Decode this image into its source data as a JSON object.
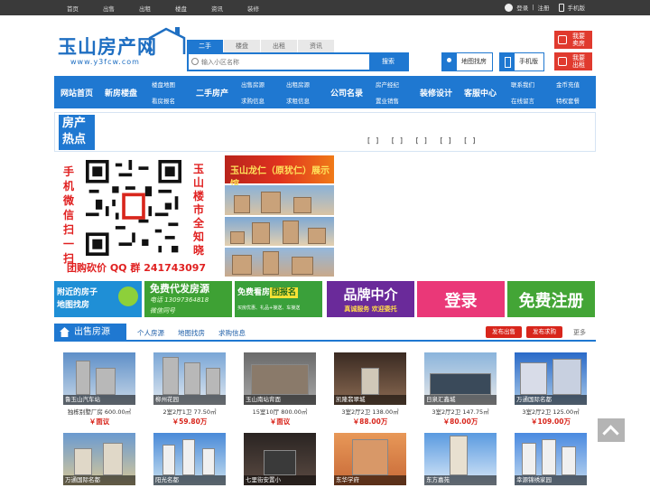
{
  "topbar": {
    "nav": [
      "首页",
      "出售",
      "出租",
      "楼盘",
      "资讯",
      "装修"
    ],
    "login": "登录",
    "separator": "|",
    "register": "注册",
    "mobile": "手机版"
  },
  "logo": {
    "title": "玉山房产网",
    "url": "www.y3fcw.com"
  },
  "search": {
    "tabs": [
      "二手",
      "楼盘",
      "出租",
      "资讯"
    ],
    "placeholder": "输入小区名称",
    "button": "搜索"
  },
  "header_buttons": {
    "map": "地图找房",
    "mobile": "手机版",
    "sell": [
      "我要",
      "卖房"
    ],
    "rent": [
      "我要",
      "出租"
    ]
  },
  "menu": {
    "home": "网站首页",
    "new": "新房楼盘",
    "new_sub": [
      "楼盘地图",
      "看房报名"
    ],
    "second": "二手房产",
    "second_sub": [
      "出售房源",
      "求购信息"
    ],
    "rent_sub": [
      "出租房源",
      "求租信息"
    ],
    "company": "公司名录",
    "company_sub": [
      "房产经纪",
      "置业销售"
    ],
    "decor": "装修设计",
    "service": "客服中心",
    "service_sub": [
      "联系我们",
      "在线留言"
    ],
    "extra_sub": [
      "金币充值",
      "特权套餐"
    ]
  },
  "hot": {
    "label_1": "房产",
    "label_2": "热点",
    "marks": "[] [] [] [] []"
  },
  "qr_ad": {
    "left": "手机微信扫一扫",
    "right": "玉山楼市全知晓",
    "bottom": "团购砍价 QQ 群 241743097"
  },
  "side_ads": {
    "top": "玉山龙仁（原犹仁）展示馆"
  },
  "banners": {
    "b1": [
      "附近的房子",
      "地图找房"
    ],
    "b2_title": "免费代发房源",
    "b2_phone": "电话 13097364818",
    "b2_sub": "微信同号",
    "b3_a": "免费看房",
    "b3_b": "团报名",
    "b3_sub": "买房优惠、礼品+接送、车接送",
    "b4_title": "品牌中介",
    "b4_sub": "真诚服务 欢迎委托",
    "b5": "登录",
    "b6": "免费注册"
  },
  "section": {
    "title": "出售房源",
    "links": [
      "个人房源",
      "地图找房",
      "求购信息"
    ],
    "publish_sale": "发布出售",
    "publish_buy": "发布求购",
    "more": "更多"
  },
  "listings_row1": [
    {
      "name": "鲁玉山汽车站",
      "spec": "独栋别墅厂房",
      "area": "600.00㎡",
      "price": "￥面议"
    },
    {
      "name": "柳州花园",
      "spec": "2室2厅1卫",
      "area": "77.50㎡",
      "price": "￥59.80万"
    },
    {
      "name": "玉山南站背面",
      "spec": "15室10厅",
      "area": "800.00㎡",
      "price": "￥面议"
    },
    {
      "name": "凯隆翡翠城",
      "spec": "3室2厅2卫",
      "area": "138.00㎡",
      "price": "￥88.00万"
    },
    {
      "name": "日泉汇鑫城",
      "spec": "3室2厅2卫",
      "area": "147.75㎡",
      "price": "￥80.00万"
    },
    {
      "name": "万通国际名都",
      "spec": "3室2厅2卫",
      "area": "125.00㎡",
      "price": "￥109.00万"
    }
  ],
  "listings_row2": [
    {
      "name": "万通国际名都"
    },
    {
      "name": "阳光名都"
    },
    {
      "name": "七里街安置小"
    },
    {
      "name": "东华学府"
    },
    {
      "name": "东方嘉苑"
    },
    {
      "name": "幸源锦绣家园"
    }
  ],
  "colors": {
    "brand_blue": "#1f78d1",
    "red": "#d8261c",
    "topbar": "#3a3a3a"
  }
}
